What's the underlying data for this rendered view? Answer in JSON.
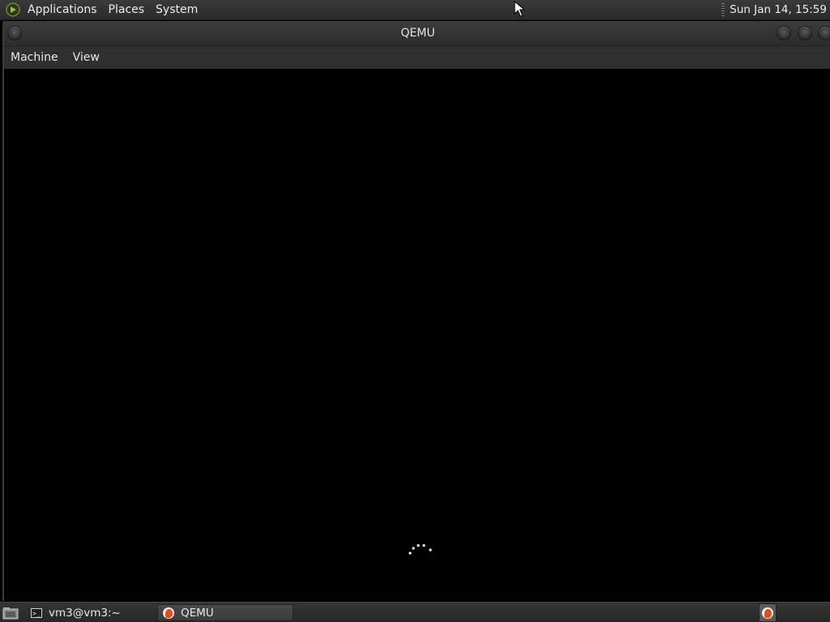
{
  "top_panel": {
    "logo_icon": "distro-logo-icon",
    "menus": [
      {
        "label": "Applications"
      },
      {
        "label": "Places"
      },
      {
        "label": "System"
      }
    ],
    "clock": "Sun Jan 14, 15:59"
  },
  "window": {
    "title": "QEMU",
    "menubar": [
      {
        "label": "Machine"
      },
      {
        "label": "View"
      }
    ],
    "display_state": "boot-spinner"
  },
  "taskbar": {
    "tasks": [
      {
        "label": "vm3@vm3:~",
        "icon": "terminal-icon",
        "active": false
      },
      {
        "label": "QEMU",
        "icon": "qemu-icon",
        "active": true
      }
    ],
    "tray_icon": "qemu-icon"
  },
  "colors": {
    "panel": "#2f2f2f",
    "display": "#000000",
    "qemu_accent": "#e0501a"
  }
}
